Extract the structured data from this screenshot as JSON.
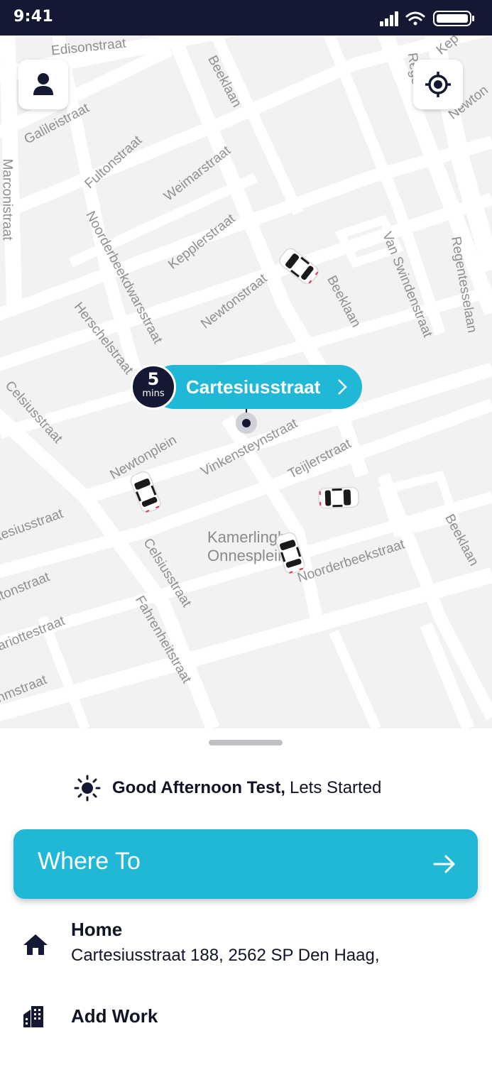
{
  "status_bar": {
    "time": "9:41"
  },
  "map": {
    "streets": {
      "edison": "Edisonstraat",
      "galilei": "Galileistraat",
      "marconi": "Marconistraat",
      "fulton": "Fultonstraat",
      "weimar": "Weimarstraat",
      "beeklaan_top": "Beeklaan",
      "regen_top": "Rege",
      "kepler_top": "Kep",
      "newton_top": "Newton",
      "noorderbeekdwars": "Noorderbeekdwarsstraat",
      "kepplerstraat": "Kepplerstraat",
      "newtonstraat": "Newtonstraat",
      "beeklaan_mid": "Beeklaan",
      "van_swinden": "Van Swindenstraat",
      "regentesse": "Regentesselaan",
      "herschel": "Herschelstraat",
      "celsius_left": "Celsiusstraat",
      "newtonplein": "Newtonplein",
      "vinkensteyn": "Vinkensteynstraat",
      "teijler": "Teijlerstraat",
      "cartesius_left": "rtesiusstraat",
      "kamerlingh": "Kamerlingh",
      "onnesplein": "Onnesplein",
      "celsius_mid": "Celsiusstraat",
      "noorderbeek": "Noorderbeekstraat",
      "beeklaan_bottom": "Beeklaan",
      "fulton_left": "ltonstraat",
      "mariotte": "ariottestraat",
      "fahrenheit": "Fahrenheitstraat",
      "nmstraat": "nmstraat"
    },
    "pickup": {
      "eta_value": "5",
      "eta_unit": "mins",
      "street": "Cartesiusstraat"
    },
    "profile_icon": "person-icon",
    "locate_icon": "crosshair-icon"
  },
  "sheet": {
    "greeting_icon": "sun-icon",
    "greeting_bold": "Good Afternoon Test,",
    "greeting_rest": "Lets Started",
    "where_to": "Where To",
    "home": {
      "title": "Home",
      "address": "Cartesiusstraat 188, 2562 SP Den Haag,",
      "icon": "home-icon"
    },
    "work": {
      "title": "Add Work",
      "icon": "office-building-icon"
    }
  },
  "colors": {
    "accent": "#20b8d6",
    "dark": "#141833",
    "map_bg": "#f2f2f2",
    "road": "#ffffff",
    "street_text": "#8f8f94"
  }
}
